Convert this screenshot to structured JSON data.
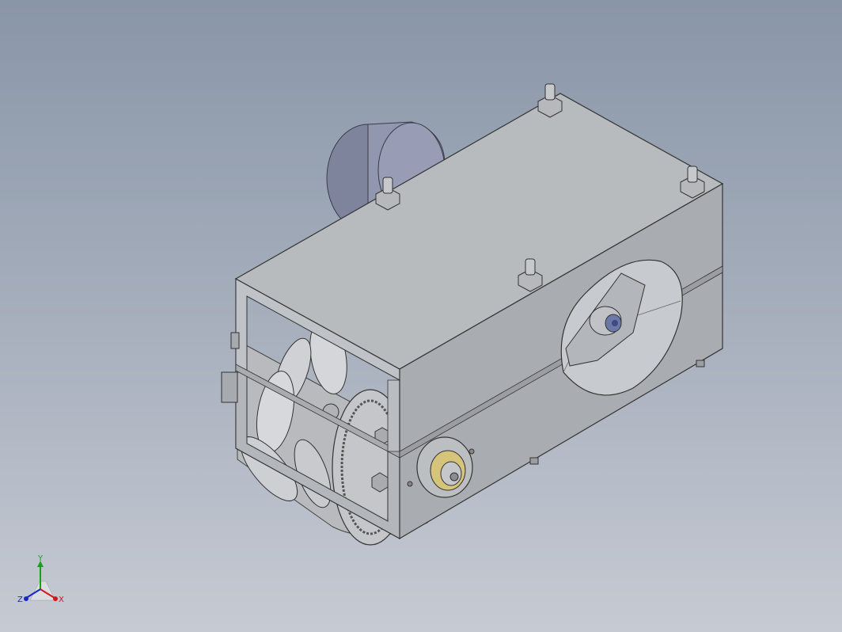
{
  "viewport": {
    "background_top": "#8996a8",
    "background_bottom": "#c6cad3"
  },
  "model": {
    "frame_color": "#b6b9bd",
    "motor_color": "#8b90a8",
    "roller_color": "#cfd1d4",
    "bearing_color": "#c9b66a"
  },
  "triad": {
    "x_label": "X",
    "y_label": "Y",
    "z_label": "Z",
    "x_color": "#d01818",
    "y_color": "#18a018",
    "z_color": "#1828c8"
  }
}
